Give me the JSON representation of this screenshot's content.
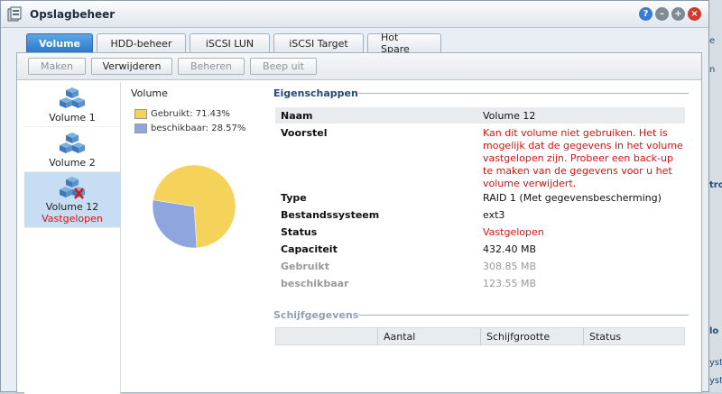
{
  "window": {
    "title": "Opslagbeheer"
  },
  "tabs": [
    {
      "label": "Volume",
      "active": true
    },
    {
      "label": "HDD-beheer",
      "active": false
    },
    {
      "label": "iSCSI LUN",
      "active": false
    },
    {
      "label": "iSCSI Target",
      "active": false
    },
    {
      "label": "Hot Spare",
      "active": false
    }
  ],
  "toolbar": {
    "create": "Maken",
    "delete": "Verwijderen",
    "manage": "Beheren",
    "beep_off": "Beep uit"
  },
  "volumes": [
    {
      "label": "Volume 1",
      "status": ""
    },
    {
      "label": "Volume 2",
      "status": ""
    },
    {
      "label": "Volume 12",
      "status": "Vastgelopen",
      "selected": true
    }
  ],
  "chart": {
    "title": "Volume"
  },
  "chart_data": {
    "type": "pie",
    "labels": [
      "Gebruikt: 71.43%",
      "beschikbaar: 28.57%"
    ],
    "values": [
      71.43,
      28.57
    ],
    "colors": [
      "#f5d35a",
      "#8fa5dd"
    ]
  },
  "properties": {
    "title": "Eigenschappen",
    "name_label": "Naam",
    "name_value": "Volume 12",
    "advice_label": "Voorstel",
    "advice_value": "Kan dit volume niet gebruiken. Het is mogelijk dat de gegevens in het volume vastgelopen zijn. Probeer een back-up te maken van de gegevens voor u het volume verwijdert.",
    "type_label": "Type",
    "type_value": "RAID 1 (Met gegevensbescherming)",
    "fs_label": "Bestandssysteem",
    "fs_value": "ext3",
    "status_label": "Status",
    "status_value": "Vastgelopen",
    "capacity_label": "Capaciteit",
    "capacity_value": "432.40 MB",
    "used_label": "Gebruikt",
    "used_value": "308.85 MB",
    "available_label": "beschikbaar",
    "available_value": "123.55 MB"
  },
  "disks": {
    "title": "Schijfgegevens",
    "columns": [
      "",
      "Aantal",
      "Schijfgrootte",
      "Status"
    ]
  },
  "side": {
    "texts": [
      "e",
      "n",
      "tro",
      "lo",
      "yst",
      "yst"
    ]
  }
}
